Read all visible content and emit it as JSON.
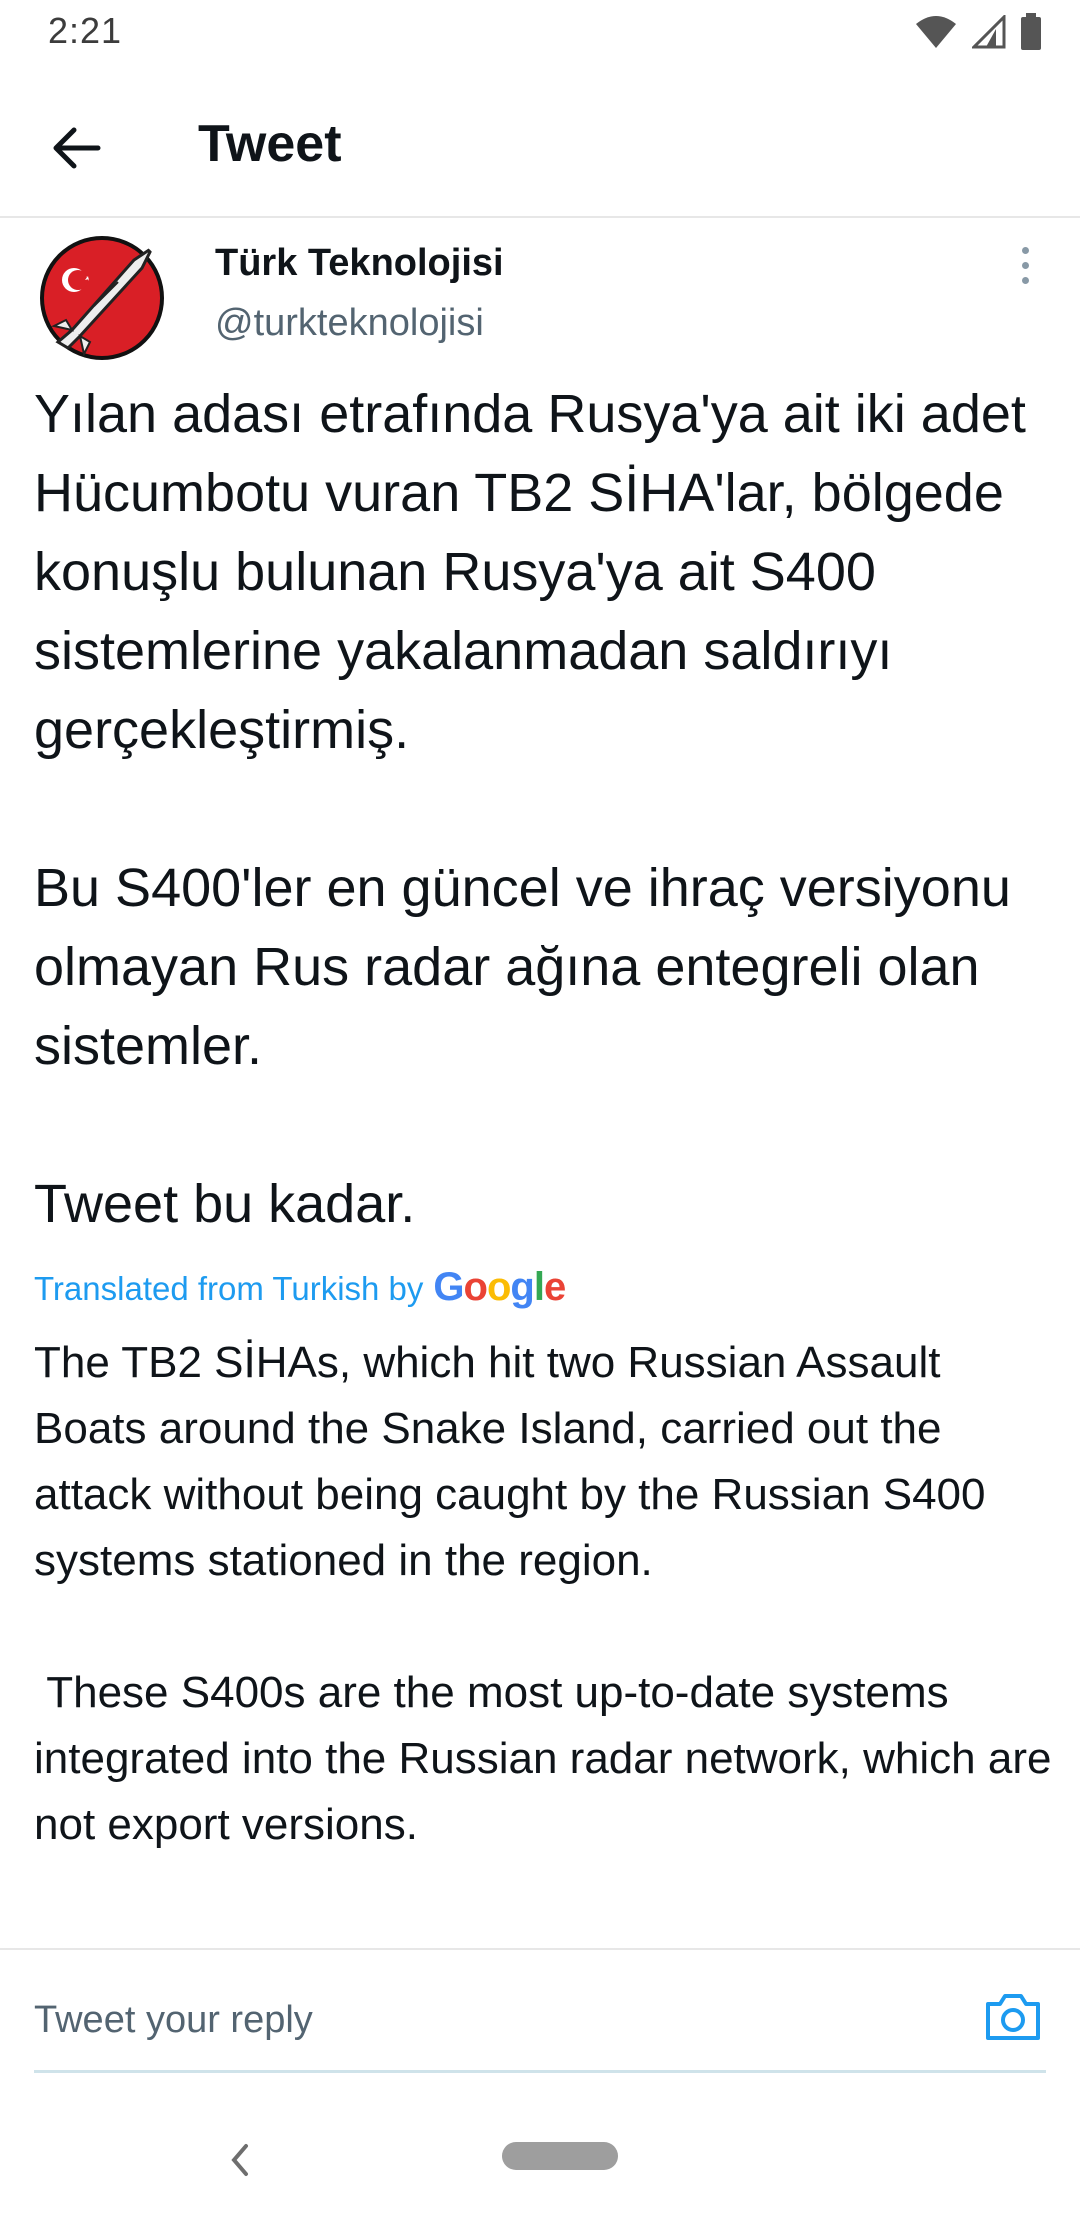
{
  "status_bar": {
    "time": "2:21",
    "icons": [
      "wifi-icon",
      "signal-icon",
      "battery-icon"
    ]
  },
  "header": {
    "back_icon": "arrow-left-icon",
    "title": "Tweet"
  },
  "tweet": {
    "author_name": "Türk Teknolojisi",
    "author_handle": "@turkteknolojisi",
    "avatar_icon": "rocket-logo",
    "more_icon": "more-vertical-icon",
    "paragraphs": [
      "Yılan adası etrafında Rusya'ya ait iki adet Hücumbotu vuran TB2 SİHA'lar, bölgede konuşlu bulunan Rusya'ya ait S400 sistemlerine yakalanmadan saldırıyı gerçekleştirmiş.",
      "Bu S400'ler en güncel ve ihraç versiyonu olmayan Rus radar ağına entegreli olan sistemler.",
      "Tweet bu kadar."
    ],
    "translated_label": "Translated from Turkish by",
    "translation_provider": "Google",
    "translation_paragraphs": [
      "The TB2 SİHAs, which hit two Russian Assault Boats around the Snake Island, carried out the attack without being caught by the Russian S400 systems stationed in the region.",
      " These S400s are the most up-to-date systems integrated into the Russian radar network, which are not export versions."
    ]
  },
  "reply": {
    "placeholder": "Tweet your reply",
    "camera_icon": "camera-icon"
  },
  "nav_bar": {
    "back_icon": "chevron-left-icon",
    "home_icon": "home-pill-icon"
  },
  "colors": {
    "accent": "#1d9bf0",
    "secondary_text": "#536471",
    "primary_text": "#0f1419",
    "divider": "#e7e7e7"
  }
}
